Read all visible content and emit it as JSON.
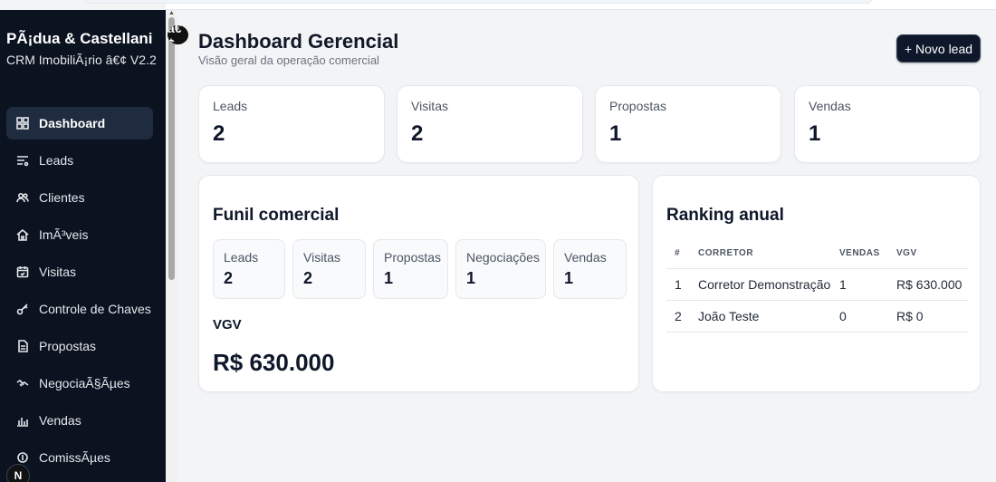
{
  "sidebar": {
    "brand_name": "PÃ¡dua & Castellani",
    "brand_sub": "CRM ImobiliÃ¡rio â€¢ V2.2",
    "items": [
      {
        "label": "Dashboard",
        "icon": "grid-icon"
      },
      {
        "label": "Leads",
        "icon": "filter-list-icon"
      },
      {
        "label": "Clientes",
        "icon": "users-icon"
      },
      {
        "label": "ImÃ³veis",
        "icon": "home-icon"
      },
      {
        "label": "Visitas",
        "icon": "calendar-icon"
      },
      {
        "label": "Controle de Chaves",
        "icon": "key-icon"
      },
      {
        "label": "Propostas",
        "icon": "document-icon"
      },
      {
        "label": "NegociaÃ§Ãµes",
        "icon": "handshake-icon"
      },
      {
        "label": "Vendas",
        "icon": "bar-chart-icon"
      },
      {
        "label": "ComissÃµes",
        "icon": "coins-icon"
      }
    ],
    "avatar_letter": "N",
    "badge_text": "â€¢"
  },
  "header": {
    "title": "Dashboard Gerencial",
    "subtitle": "Visão geral da operação comercial",
    "new_lead_label": "+ Novo lead"
  },
  "stats": [
    {
      "label": "Leads",
      "value": "2"
    },
    {
      "label": "Visitas",
      "value": "2"
    },
    {
      "label": "Propostas",
      "value": "1"
    },
    {
      "label": "Vendas",
      "value": "1"
    }
  ],
  "funnel": {
    "title": "Funil comercial",
    "steps": [
      {
        "label": "Leads",
        "value": "2"
      },
      {
        "label": "Visitas",
        "value": "2"
      },
      {
        "label": "Propostas",
        "value": "1"
      },
      {
        "label": "Negociações",
        "value": "1"
      },
      {
        "label": "Vendas",
        "value": "1"
      }
    ],
    "vgv_label": "VGV",
    "vgv_value": "R$ 630.000"
  },
  "ranking": {
    "title": "Ranking anual",
    "columns": [
      "#",
      "CORRETOR",
      "VENDAS",
      "VGV"
    ],
    "rows": [
      {
        "pos": "1",
        "name": "Corretor Demonstração",
        "sales": "1",
        "vgv": "R$ 630.000"
      },
      {
        "pos": "2",
        "name": "João Teste",
        "sales": "0",
        "vgv": "R$ 0"
      }
    ]
  },
  "colors": {
    "sidebar_bg": "#0b1220",
    "active_item_bg": "#1f2b3e",
    "button_bg": "#0f172a",
    "page_bg": "#f3f4f6"
  }
}
